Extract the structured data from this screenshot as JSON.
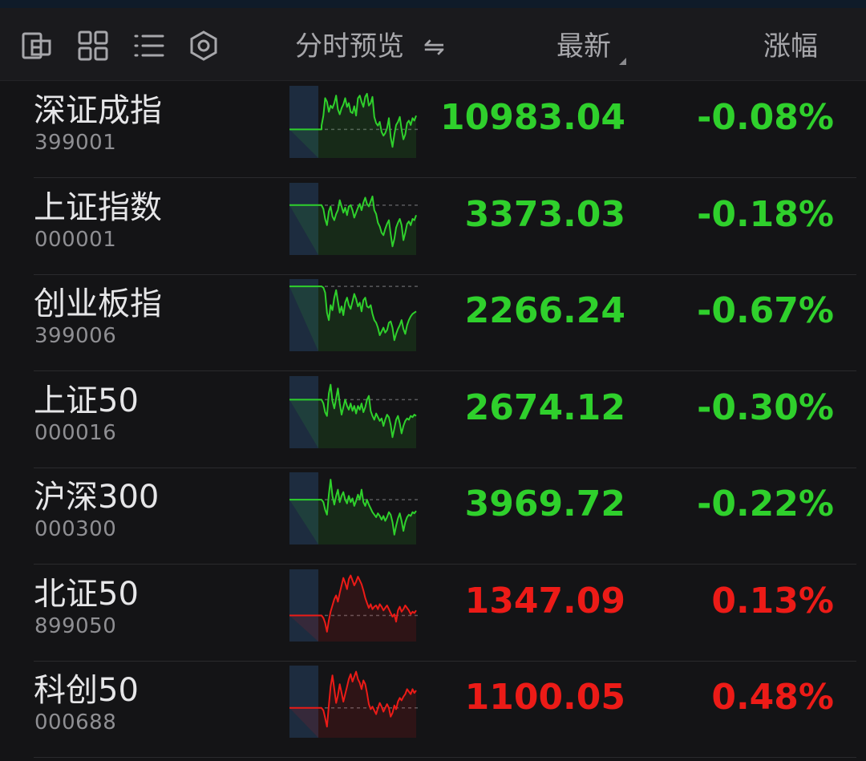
{
  "header": {
    "icons": [
      "multi-window-icon",
      "grid-view-icon",
      "list-view-icon",
      "settings-icon"
    ],
    "preview_label": "分时预览",
    "swap_glyph": "⇋",
    "latest_label": "最新",
    "change_label": "涨幅"
  },
  "colors": {
    "down": "#2fd02c",
    "up": "#ec1b17",
    "bg": "#141416"
  },
  "rows": [
    {
      "name": "深证成指",
      "code": "399001",
      "price": "10983.04",
      "change": "-0.08%",
      "dir": "down",
      "spark": [
        0.62,
        0.62,
        0.62,
        0.62,
        0.56,
        0.4,
        0.12,
        0.18,
        0.34,
        0.24,
        0.28,
        0.2,
        0.08,
        0.3,
        0.38,
        0.28,
        0.22,
        0.12,
        0.26,
        0.2,
        0.34,
        0.36,
        0.25,
        0.4,
        0.12,
        0.08,
        0.18,
        0.26,
        0.1,
        0.05,
        0.24,
        0.2,
        0.1,
        0.42,
        0.52,
        0.56,
        0.5,
        0.66,
        0.72,
        0.68,
        0.6,
        0.44,
        0.74,
        0.9,
        0.7,
        0.55,
        0.5,
        0.42,
        0.62,
        0.78,
        0.7,
        0.52,
        0.48,
        0.55,
        0.44,
        0.48,
        0.4
      ]
    },
    {
      "name": "上证指数",
      "code": "000001",
      "price": "3373.03",
      "change": "-0.18%",
      "dir": "down",
      "spark": [
        0.28,
        0.28,
        0.28,
        0.28,
        0.28,
        0.34,
        0.5,
        0.6,
        0.38,
        0.3,
        0.46,
        0.52,
        0.42,
        0.36,
        0.2,
        0.3,
        0.4,
        0.32,
        0.44,
        0.3,
        0.28,
        0.36,
        0.48,
        0.4,
        0.32,
        0.26,
        0.36,
        0.24,
        0.16,
        0.26,
        0.3,
        0.22,
        0.14,
        0.36,
        0.42,
        0.56,
        0.62,
        0.72,
        0.76,
        0.66,
        0.58,
        0.52,
        0.74,
        0.94,
        0.82,
        0.64,
        0.56,
        0.5,
        0.6,
        0.84,
        0.72,
        0.58,
        0.54,
        0.6,
        0.5,
        0.52,
        0.44
      ]
    },
    {
      "name": "创业板指",
      "code": "399006",
      "price": "2266.24",
      "change": "-0.67%",
      "dir": "down",
      "spark": [
        0.04,
        0.04,
        0.04,
        0.04,
        0.04,
        0.06,
        0.14,
        0.46,
        0.58,
        0.34,
        0.42,
        0.22,
        0.1,
        0.28,
        0.46,
        0.36,
        0.5,
        0.3,
        0.22,
        0.34,
        0.4,
        0.28,
        0.16,
        0.24,
        0.36,
        0.3,
        0.44,
        0.26,
        0.22,
        0.36,
        0.38,
        0.34,
        0.48,
        0.58,
        0.62,
        0.7,
        0.82,
        0.76,
        0.7,
        0.78,
        0.74,
        0.62,
        0.6,
        0.7,
        0.9,
        0.8,
        0.72,
        0.66,
        0.58,
        0.72,
        0.8,
        0.66,
        0.58,
        0.52,
        0.48,
        0.46,
        0.44
      ]
    },
    {
      "name": "上证50",
      "code": "000016",
      "price": "2674.12",
      "change": "-0.30%",
      "dir": "down",
      "spark": [
        0.3,
        0.3,
        0.3,
        0.3,
        0.3,
        0.36,
        0.5,
        0.56,
        0.2,
        0.06,
        0.32,
        0.44,
        0.28,
        0.12,
        0.36,
        0.54,
        0.42,
        0.3,
        0.4,
        0.46,
        0.36,
        0.48,
        0.4,
        0.52,
        0.4,
        0.46,
        0.36,
        0.5,
        0.42,
        0.3,
        0.24,
        0.48,
        0.56,
        0.62,
        0.52,
        0.58,
        0.64,
        0.6,
        0.72,
        0.62,
        0.54,
        0.58,
        0.7,
        0.9,
        0.76,
        0.62,
        0.56,
        0.68,
        0.84,
        0.72,
        0.64,
        0.6,
        0.62,
        0.56,
        0.58,
        0.54,
        0.56
      ]
    },
    {
      "name": "沪深300",
      "code": "000300",
      "price": "3969.72",
      "change": "-0.22%",
      "dir": "down",
      "spark": [
        0.36,
        0.36,
        0.36,
        0.36,
        0.36,
        0.4,
        0.52,
        0.6,
        0.28,
        0.04,
        0.3,
        0.44,
        0.3,
        0.2,
        0.4,
        0.3,
        0.24,
        0.36,
        0.42,
        0.3,
        0.4,
        0.34,
        0.46,
        0.38,
        0.28,
        0.36,
        0.2,
        0.4,
        0.46,
        0.36,
        0.44,
        0.5,
        0.56,
        0.6,
        0.64,
        0.58,
        0.62,
        0.68,
        0.62,
        0.7,
        0.64,
        0.56,
        0.6,
        0.72,
        0.92,
        0.78,
        0.66,
        0.58,
        0.7,
        0.86,
        0.72,
        0.64,
        0.6,
        0.62,
        0.56,
        0.58,
        0.54
      ]
    },
    {
      "name": "北证50",
      "code": "899050",
      "price": "1347.09",
      "change": "0.13%",
      "dir": "up",
      "spark": [
        0.66,
        0.66,
        0.66,
        0.66,
        0.66,
        0.7,
        0.78,
        0.92,
        0.74,
        0.6,
        0.5,
        0.4,
        0.34,
        0.44,
        0.3,
        0.18,
        0.06,
        0.14,
        0.24,
        0.08,
        0.02,
        0.1,
        0.18,
        0.12,
        0.04,
        0.1,
        0.16,
        0.26,
        0.38,
        0.46,
        0.54,
        0.48,
        0.56,
        0.52,
        0.5,
        0.56,
        0.48,
        0.52,
        0.58,
        0.54,
        0.5,
        0.56,
        0.62,
        0.68,
        0.64,
        0.76,
        0.58,
        0.52,
        0.6,
        0.56,
        0.5,
        0.54,
        0.58,
        0.64,
        0.6,
        0.62,
        0.58
      ]
    },
    {
      "name": "科创50",
      "code": "000688",
      "price": "1100.05",
      "change": "0.48%",
      "dir": "up",
      "spark": [
        0.6,
        0.6,
        0.6,
        0.6,
        0.6,
        0.64,
        0.76,
        0.9,
        0.56,
        0.26,
        0.08,
        0.3,
        0.52,
        0.4,
        0.22,
        0.36,
        0.5,
        0.38,
        0.26,
        0.14,
        0.06,
        0.18,
        0.1,
        0.02,
        0.14,
        0.2,
        0.3,
        0.16,
        0.22,
        0.36,
        0.54,
        0.62,
        0.58,
        0.64,
        0.7,
        0.6,
        0.52,
        0.58,
        0.66,
        0.6,
        0.54,
        0.6,
        0.74,
        0.68,
        0.56,
        0.62,
        0.5,
        0.44,
        0.48,
        0.42,
        0.38,
        0.3,
        0.34,
        0.38,
        0.3,
        0.36,
        0.32
      ]
    }
  ]
}
